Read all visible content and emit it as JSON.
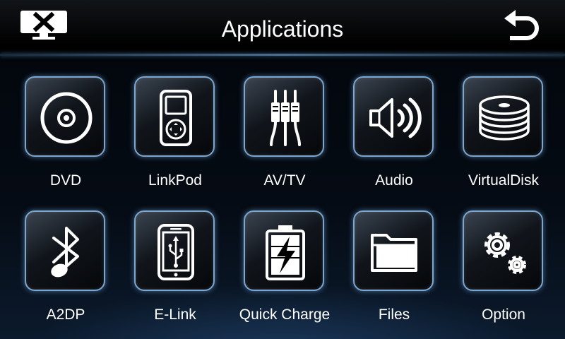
{
  "header": {
    "title": "Applications"
  },
  "icons": {
    "close": "close-screen-icon",
    "back": "back-arrow-icon"
  },
  "apps": [
    {
      "label": "DVD",
      "icon": "disc-icon"
    },
    {
      "label": "LinkPod",
      "icon": "media-player-icon"
    },
    {
      "label": "AV/TV",
      "icon": "av-cable-icon"
    },
    {
      "label": "Audio",
      "icon": "speaker-icon"
    },
    {
      "label": "VirtualDisk",
      "icon": "disc-stack-icon"
    },
    {
      "label": "A2DP",
      "icon": "bluetooth-music-icon"
    },
    {
      "label": "E-Link",
      "icon": "phone-usb-icon"
    },
    {
      "label": "Quick Charge",
      "icon": "battery-charge-icon"
    },
    {
      "label": "Files",
      "icon": "folder-icon"
    },
    {
      "label": "Option",
      "icon": "gears-icon"
    }
  ],
  "colors": {
    "tile_border": "#7aa6cf",
    "accent_line": "#4a6f92"
  }
}
